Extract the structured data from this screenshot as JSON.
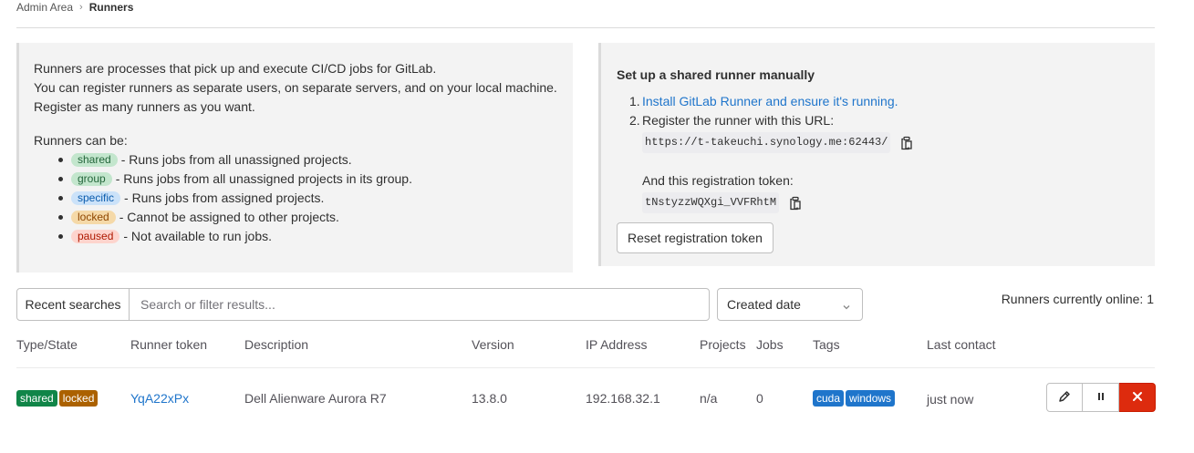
{
  "breadcrumb": {
    "parent": "Admin Area",
    "current": "Runners"
  },
  "intro": {
    "lines": [
      "Runners are processes that pick up and execute CI/CD jobs for GitLab.",
      "You can register runners as separate users, on separate servers, and on your local machine.",
      "Register as many runners as you want."
    ],
    "can_be_label": "Runners can be:",
    "kinds": [
      {
        "badge": "shared",
        "desc": "- Runs jobs from all unassigned projects."
      },
      {
        "badge": "group",
        "desc": "- Runs jobs from all unassigned projects in its group."
      },
      {
        "badge": "specific",
        "desc": "- Runs jobs from assigned projects."
      },
      {
        "badge": "locked",
        "desc": "- Cannot be assigned to other projects."
      },
      {
        "badge": "paused",
        "desc": "- Not available to run jobs."
      }
    ]
  },
  "setup": {
    "title": "Set up a shared runner manually",
    "step1_num": "1.",
    "step1_link": "Install GitLab Runner and ensure it's running.",
    "step2_num": "2.",
    "step2_text": "Register the runner with this URL:",
    "url": "https://t-takeuchi.synology.me:62443/",
    "token_label": "And this registration token:",
    "token": "tNstyzzWQXgi_VVFRhtM",
    "reset_button": "Reset registration token"
  },
  "filter": {
    "recent_searches": "Recent searches",
    "placeholder": "Search or filter results...",
    "sort_value": "Created date"
  },
  "online_count_text": "Runners currently online: 1",
  "table": {
    "headers": [
      "Type/State",
      "Runner token",
      "Description",
      "Version",
      "IP Address",
      "Projects",
      "Jobs",
      "Tags",
      "Last contact"
    ],
    "rows": [
      {
        "badges": [
          "shared",
          "locked"
        ],
        "token": "YqA22xPx",
        "description": "Dell Alienware Aurora R7",
        "version": "13.8.0",
        "ip": "192.168.32.1",
        "projects": "n/a",
        "jobs": "0",
        "tags": [
          "cuda",
          "windows"
        ],
        "last_contact": "just now"
      }
    ]
  },
  "icons": {
    "copy": "copy-icon",
    "chevron": "chevron-down-icon",
    "edit": "pencil-icon",
    "pause": "pause-icon",
    "delete": "close-icon"
  },
  "colors": {
    "link": "#1f75cb",
    "shared_badge": "#108548",
    "locked_badge": "#ab6100",
    "delete_button": "#dd2b0e"
  }
}
